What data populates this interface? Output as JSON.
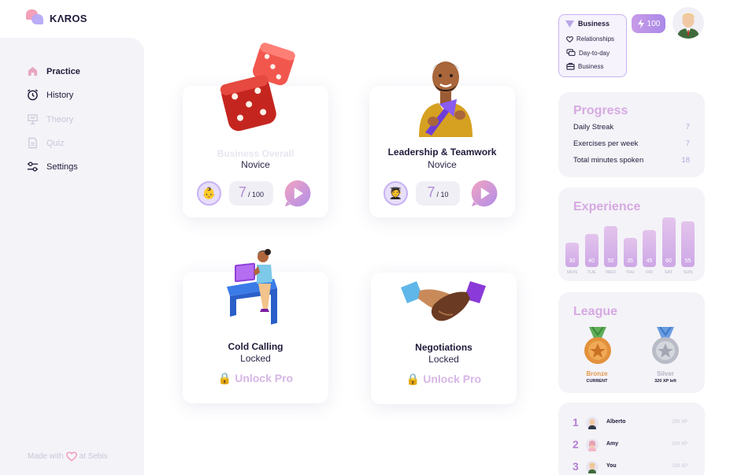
{
  "app": {
    "brand": "KΛROS"
  },
  "sidebar": {
    "items": [
      {
        "label": "Practice",
        "icon": "home-icon",
        "state": "active"
      },
      {
        "label": "History",
        "icon": "clock-icon",
        "state": "normal"
      },
      {
        "label": "Theory",
        "icon": "presentation-icon",
        "state": "disabled"
      },
      {
        "label": "Quiz",
        "icon": "document-icon",
        "state": "disabled"
      },
      {
        "label": "Settings",
        "icon": "sliders-icon",
        "state": "normal"
      }
    ],
    "footer": {
      "prefix": "Made with",
      "suffix": "at Sebis"
    }
  },
  "cards": [
    {
      "title": "Business Overall",
      "level": "Novice",
      "badge": "👶",
      "score": "7",
      "total": "/ 100",
      "illustration": "dice"
    },
    {
      "title": "Leadership & Teamwork",
      "level": "Novice",
      "badge": "🧑‍🎓",
      "score": "7",
      "total": "/ 10",
      "illustration": "man-with-arrow"
    },
    {
      "title": "Cold Calling",
      "level": "Locked",
      "cta": "Unlock Pro",
      "illustration": "woman-at-desk"
    },
    {
      "title": "Negotiations",
      "level": "Locked",
      "cta": "Unlock Pro",
      "illustration": "handshake"
    }
  ],
  "topbar": {
    "category": {
      "label": "Business",
      "options": [
        {
          "label": "Relationships",
          "icon": "heart-icon"
        },
        {
          "label": "Day-to-day",
          "icon": "chat-icon"
        },
        {
          "label": "Business",
          "icon": "briefcase-icon"
        }
      ]
    },
    "xp": "100"
  },
  "progress": {
    "title": "Progress",
    "rows": [
      {
        "label": "Daily Streak",
        "value": "7"
      },
      {
        "label": "Exercises per week",
        "value": "7"
      },
      {
        "label": "Total minutes spoken",
        "value": "18"
      }
    ]
  },
  "experience": {
    "title": "Experience",
    "bars": [
      {
        "day": "MON",
        "value": 30
      },
      {
        "day": "TUE",
        "value": 40
      },
      {
        "day": "WED",
        "value": 50
      },
      {
        "day": "THU",
        "value": 35
      },
      {
        "day": "FRI",
        "value": 45
      },
      {
        "day": "SAT",
        "value": 60
      },
      {
        "day": "SUN",
        "value": 55
      }
    ]
  },
  "league": {
    "title": "League",
    "current": {
      "name": "Bronze",
      "sub": "CURRENT"
    },
    "next": {
      "name": "Silver",
      "sub": "320 XP left"
    }
  },
  "leaderboard": [
    {
      "rank": "1",
      "name": "Alberto",
      "xp": "250 XP"
    },
    {
      "rank": "2",
      "name": "Amy",
      "xp": "200 XP"
    },
    {
      "rank": "3",
      "name": "You",
      "xp": "100 XP"
    }
  ],
  "colors": {
    "accent": "#c7b2f3",
    "pink": "#d6a9e2",
    "bg": "#f4f3f8"
  }
}
